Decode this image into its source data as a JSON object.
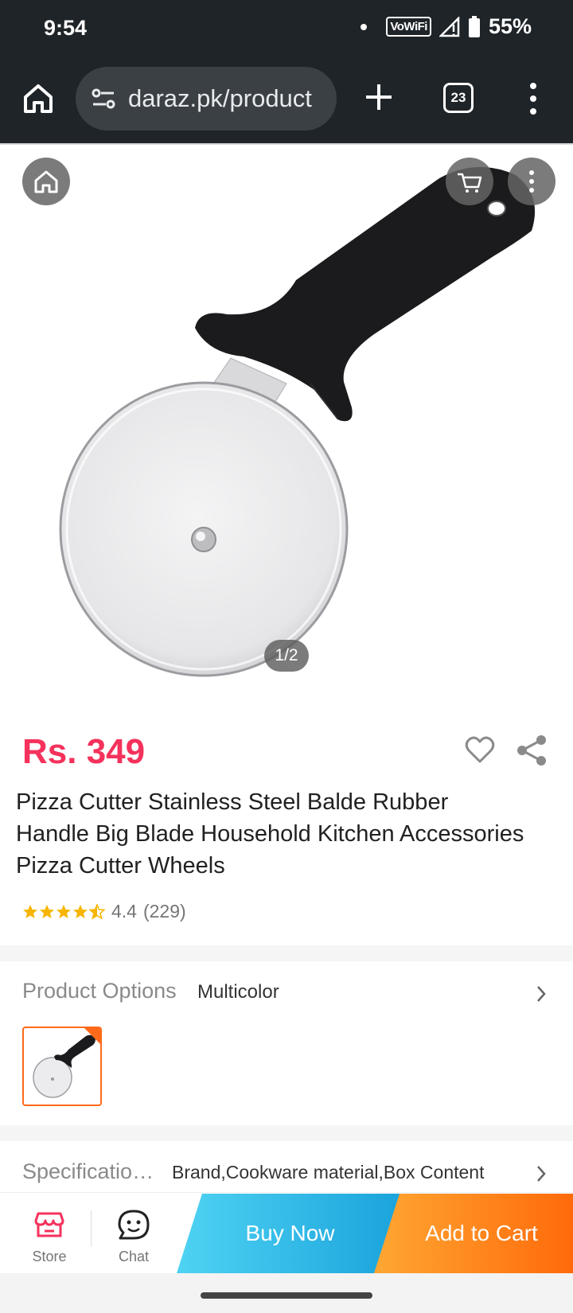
{
  "status_bar": {
    "time": "9:54",
    "network_label": "VoWiFi",
    "battery": "55%"
  },
  "browser": {
    "url": "daraz.pk/product",
    "tab_count": "23"
  },
  "gallery": {
    "counter": "1/2"
  },
  "product": {
    "price": "Rs. 349",
    "title": "Pizza Cutter Stainless Steel Balde Rubber Handle Big Blade Household Kitchen Accessories Pizza Cutter Wheels",
    "rating": "4.4",
    "reviews": "(229)",
    "rating_value": 4.4,
    "rating_max": 5
  },
  "options": {
    "label": "Product Options",
    "value": "Multicolor"
  },
  "specs": {
    "label": "Specificatio…",
    "value": "Brand,Cookware material,Box Content"
  },
  "actions": {
    "store_label": "Store",
    "chat_label": "Chat",
    "buy_now_label": "Buy Now",
    "add_to_cart_label": "Add to Cart"
  },
  "colors": {
    "price": "#f5325c",
    "buy_now_start": "#4fd3f3",
    "buy_now_end": "#1aa3dc",
    "add_cart_start": "#ffa733",
    "add_cart_end": "#ff6a0a",
    "star": "#f7b500",
    "store_icon": "#f5325c"
  },
  "icons": [
    "home-icon",
    "site-settings-icon",
    "plus-icon",
    "tabs-icon",
    "more-vert-icon",
    "cart-icon",
    "heart-icon",
    "share-icon",
    "star-icon",
    "chevron-right-icon",
    "store-icon",
    "chat-icon"
  ]
}
